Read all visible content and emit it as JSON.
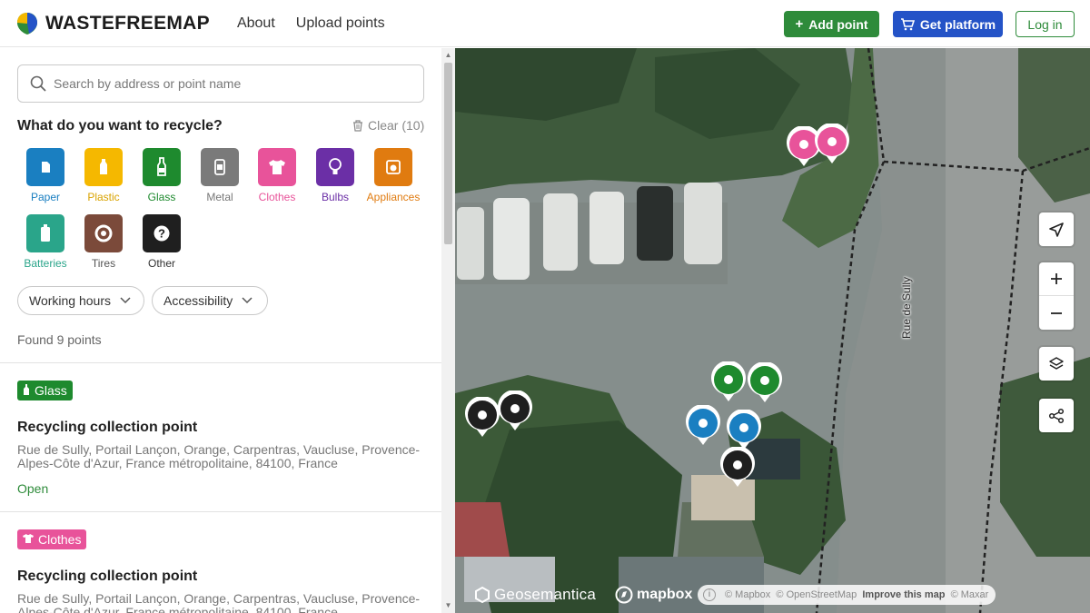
{
  "header": {
    "brand": "WASTEFREEMAP",
    "nav": [
      {
        "label": "About"
      },
      {
        "label": "Upload points"
      }
    ],
    "add_point": "Add point",
    "get_platform": "Get platform",
    "login": "Log in"
  },
  "sidebar": {
    "search_placeholder": "Search by address or point name",
    "recycle_title": "What do you want to recycle?",
    "clear": "Clear (10)",
    "categories": [
      {
        "label": "Paper",
        "color": "#1a7fc1",
        "icon": "paper-icon"
      },
      {
        "label": "Plastic",
        "color": "#f5b800",
        "icon": "bottle-icon"
      },
      {
        "label": "Glass",
        "color": "#1e8a2e",
        "icon": "glass-bottle-icon"
      },
      {
        "label": "Metal",
        "color": "#7a7a7a",
        "icon": "can-icon"
      },
      {
        "label": "Clothes",
        "color": "#e8539a",
        "icon": "shirt-icon"
      },
      {
        "label": "Bulbs",
        "color": "#6b2fa6",
        "icon": "bulb-icon"
      },
      {
        "label": "Appliances",
        "color": "#e07b10",
        "icon": "appliance-icon"
      },
      {
        "label": "Batteries",
        "color": "#2aa58a",
        "icon": "battery-icon"
      },
      {
        "label": "Tires",
        "color": "#7b4a3a",
        "icon": "tire-icon"
      },
      {
        "label": "Other",
        "color": "#1f1f1f",
        "icon": "question-icon"
      }
    ],
    "filters": [
      {
        "label": "Working hours"
      },
      {
        "label": "Accessibility"
      }
    ],
    "found": "Found 9 points",
    "results": [
      {
        "badge": "Glass",
        "badge_color": "#1e8a2e",
        "title": "Recycling collection point",
        "address": "Rue de Sully, Portail Lançon, Orange, Carpentras, Vaucluse, Provence-Alpes-Côte d'Azur, France métropolitaine, 84100, France",
        "status": "Open"
      },
      {
        "badge": "Clothes",
        "badge_color": "#e8539a",
        "title": "Recycling collection point",
        "address": "Rue de Sully, Portail Lançon, Orange, Carpentras, Vaucluse, Provence-Alpes-Côte d'Azur, France métropolitaine, 84100, France"
      }
    ]
  },
  "map": {
    "street_label": "Rue de Sully",
    "logo_geosemantica": "Geosemantica",
    "logo_mapbox": "mapbox",
    "attribution": {
      "mapbox": "© Mapbox",
      "osm": "© OpenStreetMap",
      "improve": "Improve this map",
      "maxar": "© Maxar"
    },
    "markers": [
      {
        "color": "#e8539a",
        "category": "Clothes"
      },
      {
        "color": "#e8539a",
        "category": "Clothes"
      },
      {
        "color": "#1e8a2e",
        "category": "Glass"
      },
      {
        "color": "#1e8a2e",
        "category": "Glass"
      },
      {
        "color": "#1a7fc1",
        "category": "Paper"
      },
      {
        "color": "#1a7fc1",
        "category": "Paper"
      },
      {
        "color": "#1f1f1f",
        "category": "Other"
      },
      {
        "color": "#1f1f1f",
        "category": "Other"
      },
      {
        "color": "#1f1f1f",
        "category": "Other"
      }
    ]
  }
}
